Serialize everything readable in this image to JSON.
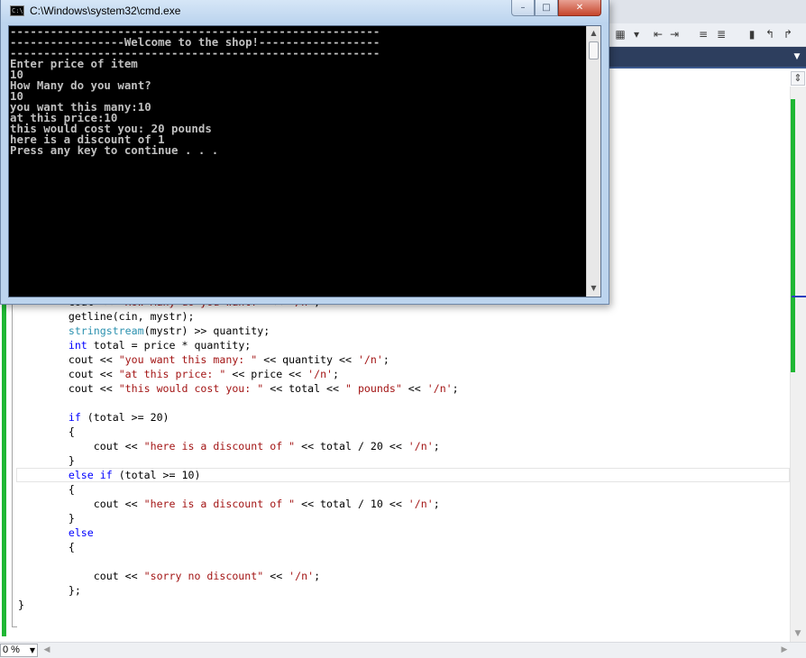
{
  "console_window": {
    "title": "C:\\Windows\\system32\\cmd.exe",
    "icon": "cmd-icon",
    "icon_label": "C:\\",
    "buttons": {
      "minimize": "–",
      "maximize": "□",
      "close": "✕"
    },
    "output_lines": [
      "-------------------------------------------------------",
      "-----------------Welcome to the shop!------------------",
      "-------------------------------------------------------",
      "Enter price of item",
      "10",
      "How Many do you want?",
      "10",
      "you want this many:10",
      "at this price:10",
      "this would cost you: 20 pounds",
      "here is a discount of 1",
      "Press any key to continue . . ."
    ]
  },
  "editor": {
    "code_lines": [
      [
        {
          "t": "        cout << ",
          "c": "plain"
        },
        {
          "t": "\"How Many do you want?\"",
          "c": "str"
        },
        {
          "t": " << ",
          "c": "plain"
        },
        {
          "t": "'/n'",
          "c": "str"
        },
        {
          "t": ";",
          "c": "plain"
        }
      ],
      [
        {
          "t": "        getline(cin, mystr);",
          "c": "plain"
        }
      ],
      [
        {
          "t": "        ",
          "c": "plain"
        },
        {
          "t": "stringstream",
          "c": "typ"
        },
        {
          "t": "(mystr) >> quantity;",
          "c": "plain"
        }
      ],
      [
        {
          "t": "        ",
          "c": "plain"
        },
        {
          "t": "int",
          "c": "kw"
        },
        {
          "t": " total = price * quantity;",
          "c": "plain"
        }
      ],
      [
        {
          "t": "        cout << ",
          "c": "plain"
        },
        {
          "t": "\"you want this many: \"",
          "c": "str"
        },
        {
          "t": " << quantity << ",
          "c": "plain"
        },
        {
          "t": "'/n'",
          "c": "str"
        },
        {
          "t": ";",
          "c": "plain"
        }
      ],
      [
        {
          "t": "        cout << ",
          "c": "plain"
        },
        {
          "t": "\"at this price: \"",
          "c": "str"
        },
        {
          "t": " << price << ",
          "c": "plain"
        },
        {
          "t": "'/n'",
          "c": "str"
        },
        {
          "t": ";",
          "c": "plain"
        }
      ],
      [
        {
          "t": "        cout << ",
          "c": "plain"
        },
        {
          "t": "\"this would cost you: \"",
          "c": "str"
        },
        {
          "t": " << total << ",
          "c": "plain"
        },
        {
          "t": "\" pounds\"",
          "c": "str"
        },
        {
          "t": " << ",
          "c": "plain"
        },
        {
          "t": "'/n'",
          "c": "str"
        },
        {
          "t": ";",
          "c": "plain"
        }
      ],
      [
        {
          "t": "",
          "c": "plain"
        }
      ],
      [
        {
          "t": "        ",
          "c": "plain"
        },
        {
          "t": "if",
          "c": "kw"
        },
        {
          "t": " (total >= 20)",
          "c": "plain"
        }
      ],
      [
        {
          "t": "        {",
          "c": "plain"
        }
      ],
      [
        {
          "t": "            cout << ",
          "c": "plain"
        },
        {
          "t": "\"here is a discount of \"",
          "c": "str"
        },
        {
          "t": " << total / 20 << ",
          "c": "plain"
        },
        {
          "t": "'/n'",
          "c": "str"
        },
        {
          "t": ";",
          "c": "plain"
        }
      ],
      [
        {
          "t": "        }",
          "c": "plain"
        }
      ],
      [
        {
          "t": "        ",
          "c": "plain"
        },
        {
          "t": "else",
          "c": "kw"
        },
        {
          "t": " ",
          "c": "plain"
        },
        {
          "t": "if",
          "c": "kw"
        },
        {
          "t": " (total >= 10)",
          "c": "plain"
        }
      ],
      [
        {
          "t": "        {",
          "c": "plain"
        }
      ],
      [
        {
          "t": "            cout << ",
          "c": "plain"
        },
        {
          "t": "\"here is a discount of \"",
          "c": "str"
        },
        {
          "t": " << total / 10 << ",
          "c": "plain"
        },
        {
          "t": "'/n'",
          "c": "str"
        },
        {
          "t": ";",
          "c": "plain"
        }
      ],
      [
        {
          "t": "        }",
          "c": "plain"
        }
      ],
      [
        {
          "t": "        ",
          "c": "plain"
        },
        {
          "t": "else",
          "c": "kw"
        }
      ],
      [
        {
          "t": "        {",
          "c": "plain"
        }
      ],
      [
        {
          "t": "",
          "c": "plain"
        }
      ],
      [
        {
          "t": "            cout << ",
          "c": "plain"
        },
        {
          "t": "\"sorry no discount\"",
          "c": "str"
        },
        {
          "t": " << ",
          "c": "plain"
        },
        {
          "t": "'/n'",
          "c": "str"
        },
        {
          "t": ";",
          "c": "plain"
        }
      ],
      [
        {
          "t": "        };",
          "c": "plain"
        }
      ],
      [
        {
          "t": "}",
          "c": "plain"
        }
      ]
    ],
    "current_line_index": 11
  },
  "status_bar": {
    "zoom": "0 %"
  },
  "colors": {
    "keyword": "#0000ff",
    "string": "#a31515",
    "type": "#2b91af",
    "change_bar": "#1fb734",
    "console_bg": "#000000",
    "console_fg": "#c0c0c0"
  }
}
